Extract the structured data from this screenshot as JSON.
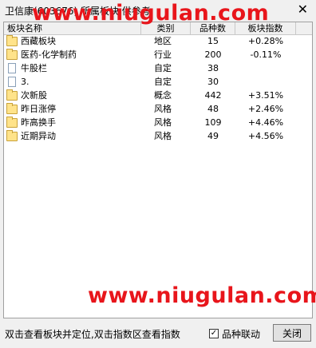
{
  "window": {
    "title": "卫信康(603676)  所属板块 供参考",
    "close_glyph": "✕"
  },
  "watermark": "www.niugulan.com",
  "columns": [
    "板块名称",
    "类别",
    "品种数",
    "板块指数"
  ],
  "rows": [
    {
      "icon": "folder",
      "name": "西藏板块",
      "type": "地区",
      "count": "15",
      "index": "+0.28%"
    },
    {
      "icon": "folder",
      "name": "医药-化学制药",
      "type": "行业",
      "count": "200",
      "index": "-0.11%"
    },
    {
      "icon": "doc",
      "name": "牛股栏",
      "type": "自定",
      "count": "38",
      "index": ""
    },
    {
      "icon": "doc",
      "name": "3.",
      "type": "自定",
      "count": "30",
      "index": ""
    },
    {
      "icon": "folder",
      "name": "次新股",
      "type": "概念",
      "count": "442",
      "index": "+3.51%"
    },
    {
      "icon": "folder",
      "name": "昨日涨停",
      "type": "风格",
      "count": "48",
      "index": "+2.46%"
    },
    {
      "icon": "folder",
      "name": "昨高换手",
      "type": "风格",
      "count": "109",
      "index": "+4.46%"
    },
    {
      "icon": "folder",
      "name": "近期异动",
      "type": "风格",
      "count": "49",
      "index": "+4.56%"
    }
  ],
  "status_text": "双击查看板块并定位,双击指数区查看指数",
  "linkage": {
    "label": "品种联动",
    "checked": true,
    "check_glyph": "✓"
  },
  "close_button": "关闭"
}
